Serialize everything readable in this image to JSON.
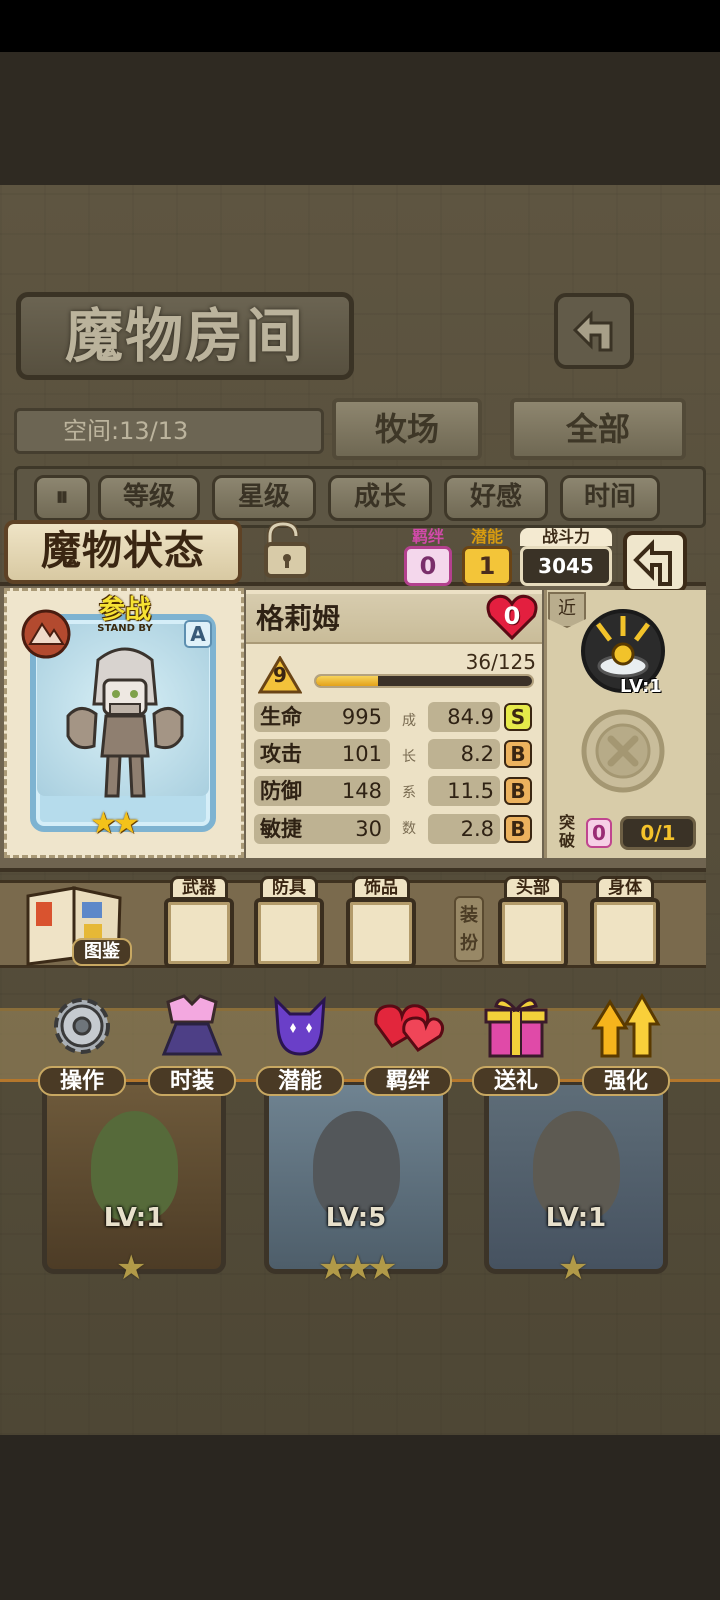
{
  "room": {
    "title": "魔物房间",
    "space_label": "空间:13/13",
    "tabs": [
      {
        "label": "牧场"
      },
      {
        "label": "全部"
      }
    ],
    "sort_options": [
      "等级",
      "星级",
      "成长",
      "好感",
      "时间"
    ]
  },
  "roster": [
    {
      "level": "LV:1",
      "stars": 1
    },
    {
      "level": "LV:5",
      "stars": 3
    },
    {
      "level": "LV:1",
      "stars": 1
    }
  ],
  "menu": [
    {
      "label": "操作",
      "icon": "gear-icon"
    },
    {
      "label": "时装",
      "icon": "outfit-icon"
    },
    {
      "label": "潜能",
      "icon": "potential-demon-icon"
    },
    {
      "label": "羁绊",
      "icon": "bond-hearts-icon"
    },
    {
      "label": "送礼",
      "icon": "gift-icon"
    },
    {
      "label": "强化",
      "icon": "upgrade-arrows-icon"
    }
  ],
  "status": {
    "title": "魔物状态",
    "bond_label": "羁绊",
    "bond_value": "0",
    "potential_label": "潜能",
    "potential_value": "1",
    "power_label": "战斗力",
    "power_value": "3045",
    "standby_label": "参战",
    "standby_sub": "STAND BY",
    "grade": "A",
    "card_stars": "★★",
    "name": "格莉姆",
    "affection": "0",
    "level": "9",
    "exp_text": "36/125",
    "exp_progress": 0.288,
    "growth_vertical": [
      "成",
      "长",
      "系",
      "数"
    ],
    "stats": [
      {
        "name": "生命",
        "value": "995",
        "growth": "84.9",
        "grade": "S"
      },
      {
        "name": "攻击",
        "value": "101",
        "growth": "8.2",
        "grade": "B"
      },
      {
        "name": "防御",
        "value": "148",
        "growth": "11.5",
        "grade": "B"
      },
      {
        "name": "敏捷",
        "value": "30",
        "growth": "2.8",
        "grade": "B"
      }
    ],
    "range_tag": "近",
    "skill_level": "LV:1",
    "breakthrough_label": "突破",
    "breakthrough_value": "0",
    "breakthrough_progress": "0/1"
  },
  "equipment": {
    "atlas_label": "图鉴",
    "slots_left": [
      "武器",
      "防具",
      "饰品"
    ],
    "dressup_label": "装扮",
    "slots_right": [
      "头部",
      "身体"
    ]
  },
  "colors": {
    "gold": "#f4c21a",
    "bond_pink": "#d14aa9",
    "grade_s": "#e6ea4a",
    "grade_b": "#ecb25e"
  }
}
